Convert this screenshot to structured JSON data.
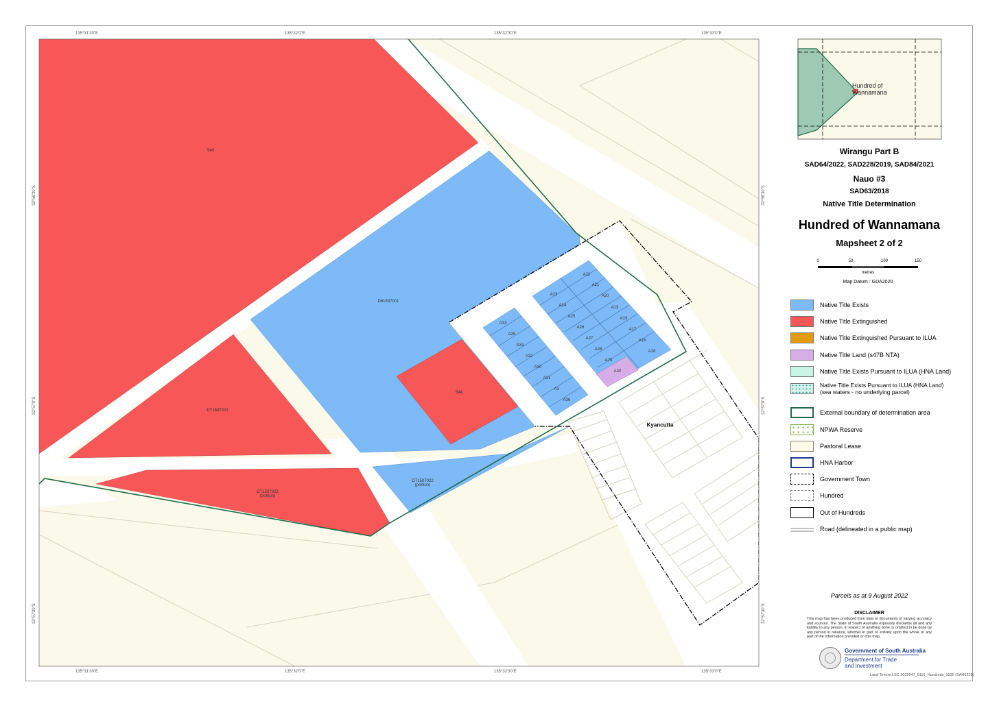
{
  "map": {
    "border_ticks_top": [
      "135°31'30\"E",
      "135°32'0\"E",
      "135°32'30\"E",
      "135°33'0\"E"
    ],
    "border_ticks_bottom": [
      "135°31'30\"E",
      "135°32'0\"E",
      "135°32'30\"E",
      "135°33'0\"E"
    ],
    "border_ticks_left": [
      "32°56'30\"S",
      "32°57'0\"S",
      "32°57'30\"S"
    ],
    "border_ticks_right": [
      "32°56'30\"S",
      "32°57'0\"S",
      "32°57'30\"S"
    ],
    "parcel_labels": {
      "p540": "540",
      "d": "D81537001",
      "p544": "544",
      "dt1": "DT1507021",
      "dt2": "DT1507022\n(portion)",
      "dt3": "DT1507022\n(portion)",
      "town": "Kyancutta"
    },
    "allotments": [
      "A22",
      "A21",
      "A23",
      "A20",
      "A24",
      "A13",
      "A25",
      "A19",
      "A26",
      "A17",
      "A27",
      "A16",
      "A28",
      "A18",
      "A29",
      "A30",
      "A33",
      "A35",
      "A34",
      "A32",
      "A30",
      "A31",
      "A3",
      "A36"
    ],
    "inset": {
      "label": "Hundred of\nWannamana"
    },
    "colors": {
      "extinguished": "#f75757",
      "exists": "#7dbaf7",
      "town_land": "#d5aee8",
      "pastoral": "#fbf9e9",
      "road": "#ffffff",
      "determination_boundary": "#1f6b4a",
      "inset_area": "#9ec9b3"
    }
  },
  "title_block": {
    "claim1": "Wirangu Part B",
    "claim1_nos": "SAD64/2022, SAD228/2019, SAD84/2021",
    "claim2": "Nauo #3",
    "claim2_no": "SAD63/2018",
    "determination": "Native Title Determination",
    "hundred": "Hundred of Wannamana",
    "mapsheet": "Mapsheet 2 of 2"
  },
  "scale_bar": {
    "ticks": [
      "0",
      "50",
      "100",
      "150"
    ],
    "unit": "metres",
    "datum": "Map Datum : GDA2020"
  },
  "legend": [
    {
      "label": "Native Title Exists",
      "icon": "swatch-blue"
    },
    {
      "label": "Native Title Extinguished",
      "icon": "swatch-red"
    },
    {
      "label": "Native Title Extinguished Pursuant to ILUA",
      "icon": "swatch-orange"
    },
    {
      "label": "Native Title Land (s47B NTA)",
      "icon": "swatch-purple"
    },
    {
      "label": "Native Title Exists Pursuant to ILUA (HNA Land)",
      "icon": "swatch-mint"
    },
    {
      "label": "Native Title Exists Pursuant to ILUA (HNA Land)\n(sea waters - no underlying parcel)",
      "icon": "swatch-dotted-teal"
    },
    {
      "label": "External boundary of determination area",
      "icon": "swatch-green-outline"
    },
    {
      "label": "NPWA Reserve",
      "icon": "swatch-green-dots"
    },
    {
      "label": "Pastoral Lease",
      "icon": "swatch-cream"
    },
    {
      "label": "HNA Harbor",
      "icon": "swatch-blue-outline"
    },
    {
      "label": "Government Town",
      "icon": "swatch-dashdot"
    },
    {
      "label": "Hundred",
      "icon": "swatch-dash"
    },
    {
      "label": "Out of Hundreds",
      "icon": "swatch-black-outline"
    },
    {
      "label": "Road (delineated in a public map)",
      "icon": "double-line"
    }
  ],
  "footer": {
    "parcels": "Parcels as at 9 August 2022",
    "disclaimer_title": "DISCLAIMER",
    "disclaimer_text": "This map has been produced from data or documents of varying accuracy and sources. The State of South Australia expressly disclaims all and any liability to any person, in respect of anything done or omitted to be done by any person in reliance, whether in part or entirely upon the whole or any part of the information provided on this map.",
    "gov_name": "Government of South Australia",
    "gov_dept": "Department for Trade\nand Investment",
    "file_ref": "Land Tenure LSC 2022047_5110_Hundreds_1030 (SAH0228)"
  }
}
